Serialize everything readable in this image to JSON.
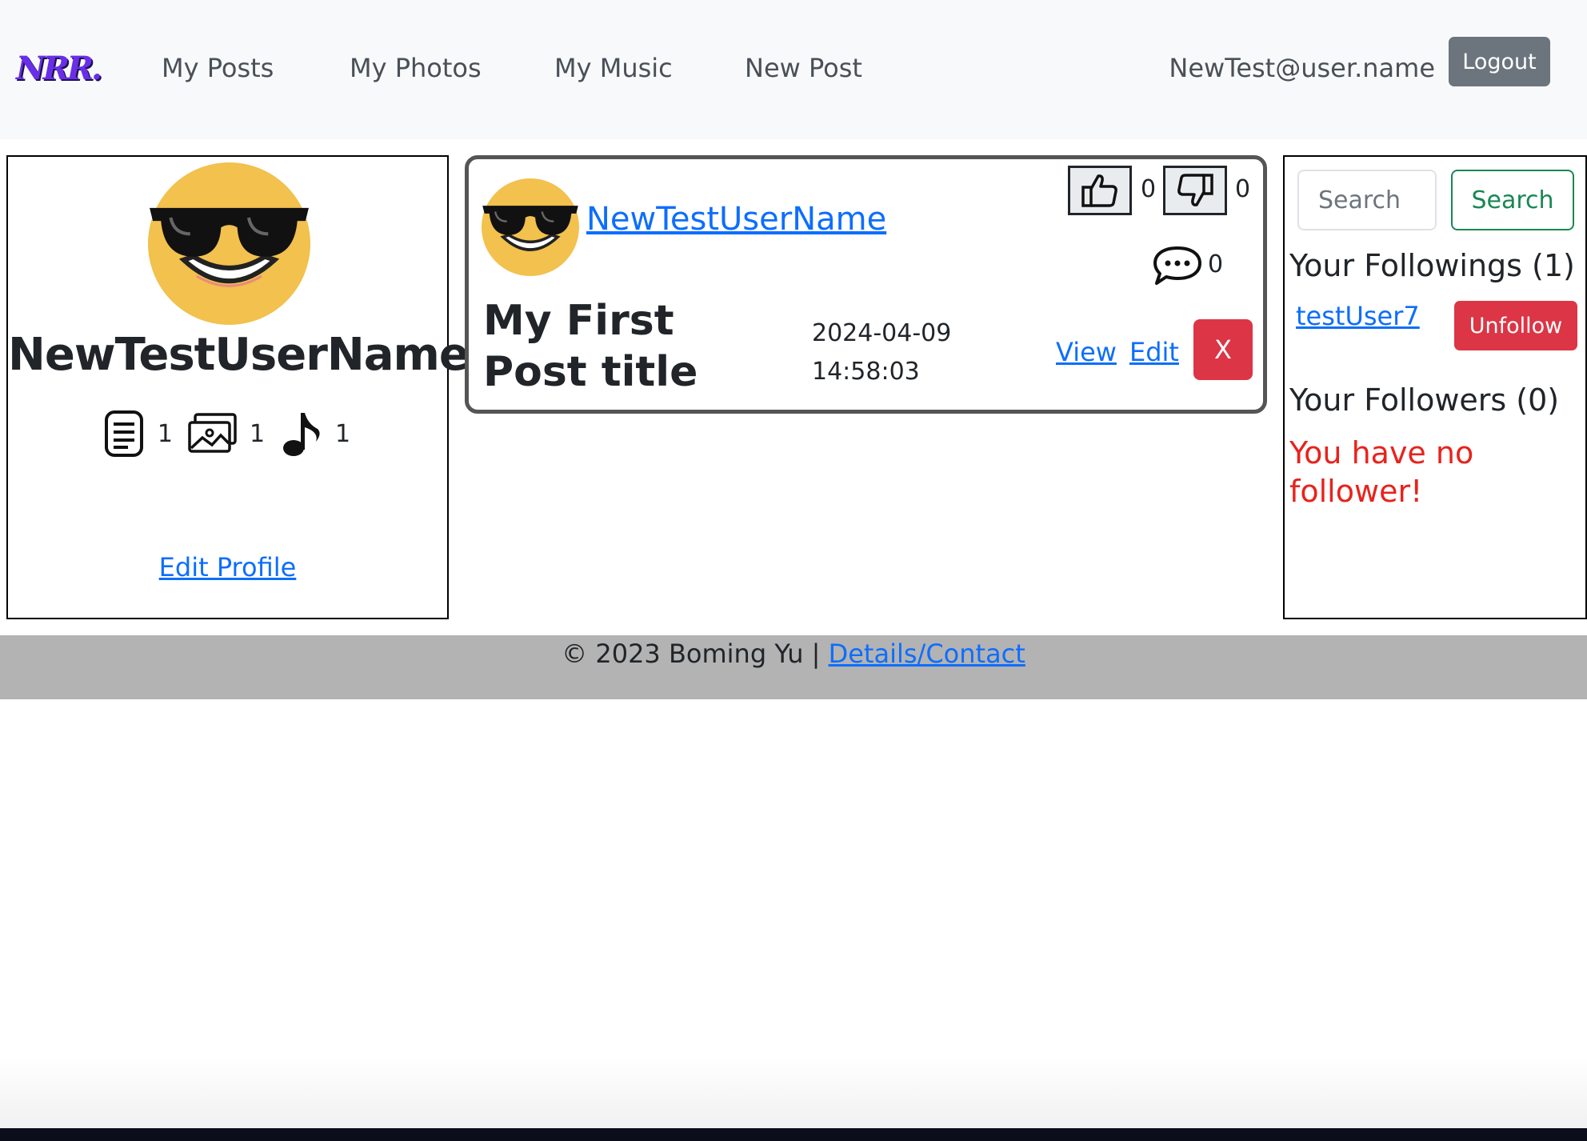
{
  "navbar": {
    "brand": "NRR.",
    "links": [
      "My Posts",
      "My Photos",
      "My Music",
      "New Post"
    ],
    "user_email": "NewTest@user.name",
    "logout_label": "Logout"
  },
  "profile": {
    "username": "NewTestUserName",
    "stats": {
      "posts_count": "1",
      "photos_count": "1",
      "music_count": "1"
    },
    "edit_profile_label": "Edit Profile"
  },
  "post": {
    "author": "NewTestUserName",
    "likes": "0",
    "dislikes": "0",
    "comments": "0",
    "title": "My First Post title",
    "date": "2024-04-09",
    "time": "14:58:03",
    "view_label": "View",
    "edit_label": "Edit",
    "delete_label": "X"
  },
  "sidebar": {
    "search_placeholder": "Search",
    "search_button": "Search",
    "followings_heading": "Your Followings (1)",
    "followings": [
      {
        "name": "testUser7",
        "action": "Unfollow"
      }
    ],
    "followers_heading": "Your Followers (0)",
    "no_followers_message": "You have no follower!"
  },
  "footer": {
    "copyright": "© 2023 Boming Yu | ",
    "link_label": "Details/Contact"
  },
  "colors": {
    "link": "#0d6efd",
    "danger": "#dc3545",
    "success": "#198754",
    "secondary": "#6c757d",
    "navbar_bg": "#f8f9fa",
    "footer_bg": "#b3b3b3",
    "brand": "#6a2ee8",
    "warning_text": "#e8231c",
    "avatar_yellow": "#f2c14e"
  },
  "icons": [
    "sunglasses-emoji-avatar",
    "document-icon",
    "images-icon",
    "music-note-icon",
    "thumbs-up-icon",
    "thumbs-down-icon",
    "comment-dots-icon"
  ]
}
